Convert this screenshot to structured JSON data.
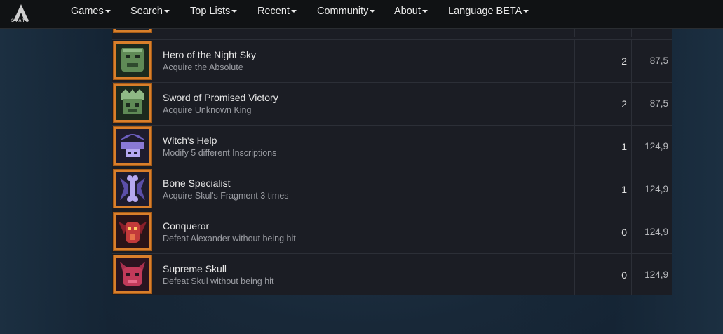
{
  "nav": {
    "logo_text": "STATS",
    "items": [
      {
        "label": "Games"
      },
      {
        "label": "Search"
      },
      {
        "label": "Top Lists"
      },
      {
        "label": "Recent"
      },
      {
        "label": "Community"
      },
      {
        "label": "About"
      },
      {
        "label": "Language BETA"
      }
    ]
  },
  "achievements": [
    {
      "name": "Hero of the Night Sky",
      "description": "Acquire the Absolute",
      "count": "2",
      "points": "87,5",
      "icon": "green-demon-icon",
      "color": "#5f8a56"
    },
    {
      "name": "Sword of Promised Victory",
      "description": "Acquire Unknown King",
      "count": "2",
      "points": "87,5",
      "icon": "green-king-icon",
      "color": "#5f8a56"
    },
    {
      "name": "Witch's Help",
      "description": "Modify 5 different Inscriptions",
      "count": "1",
      "points": "124,9",
      "icon": "purple-witch-icon",
      "color": "#8a7ad6"
    },
    {
      "name": "Bone Specialist",
      "description": "Acquire Skul's Fragment 3 times",
      "count": "1",
      "points": "124,9",
      "icon": "purple-bone-icon",
      "color": "#8a7ad6"
    },
    {
      "name": "Conqueror",
      "description": "Defeat Alexander without being hit",
      "count": "0",
      "points": "124,9",
      "icon": "red-demon-icon",
      "color": "#c23a3a"
    },
    {
      "name": "Supreme Skull",
      "description": "Defeat Skul without being hit",
      "count": "0",
      "points": "124,9",
      "icon": "red-skull-icon",
      "color": "#c23a5a"
    }
  ]
}
